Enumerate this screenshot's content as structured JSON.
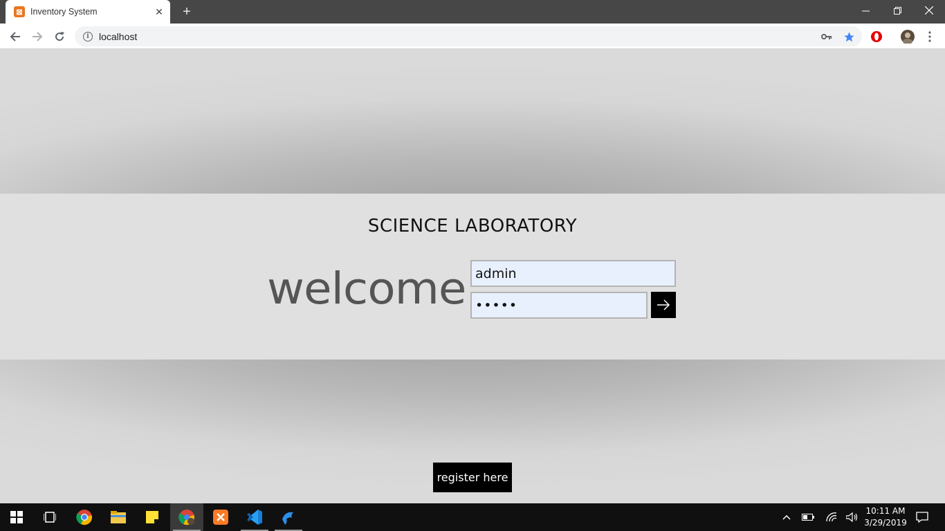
{
  "browser": {
    "tab_title": "Inventory System",
    "tab_favicon": "xampp-icon",
    "close_tab_glyph": "✕",
    "new_tab_glyph": "+",
    "url": "localhost",
    "window_controls": [
      "minimize",
      "restore",
      "close"
    ]
  },
  "page": {
    "title": "SCIENCE LABORATORY",
    "welcome_text": "welcome",
    "username_value": "admin",
    "password_mask": "•••••",
    "submit_icon": "arrow-right-icon",
    "register_label": "register here"
  },
  "taskbar": {
    "apps": [
      "start",
      "task-view",
      "chrome",
      "file-explorer",
      "sticky-notes",
      "chrome-profile",
      "xampp",
      "vscode",
      "dolphin"
    ],
    "time": "10:11 AM",
    "date": "3/29/2019"
  },
  "colors": {
    "tabbar": "#474747",
    "login_band": "#e0e0e0",
    "input_fill": "#e8f0fe",
    "button": "#000000",
    "star": "#4285f4"
  }
}
